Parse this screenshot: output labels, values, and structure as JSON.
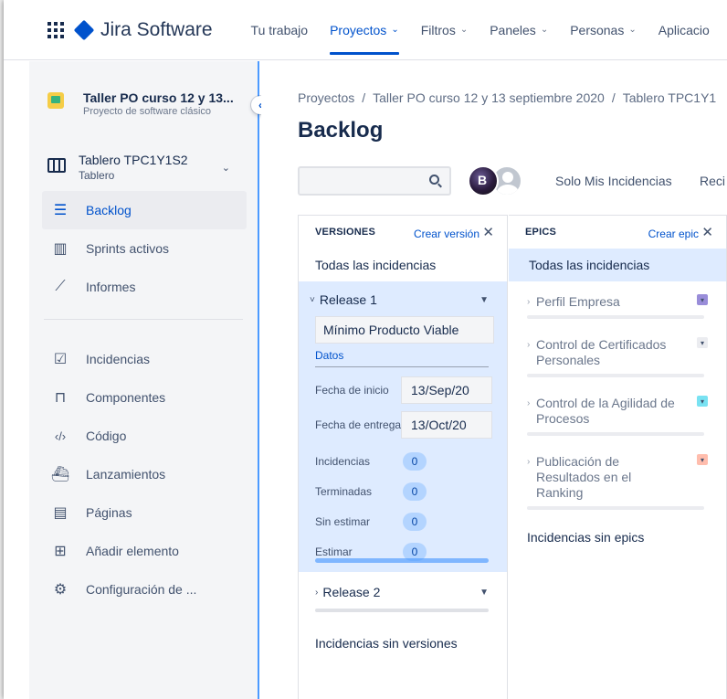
{
  "topnav": {
    "product": "Jira Software",
    "items": [
      {
        "label": "Tu trabajo",
        "chevron": false,
        "active": false
      },
      {
        "label": "Proyectos",
        "chevron": true,
        "active": true
      },
      {
        "label": "Filtros",
        "chevron": true,
        "active": false
      },
      {
        "label": "Paneles",
        "chevron": true,
        "active": false
      },
      {
        "label": "Personas",
        "chevron": true,
        "active": false
      },
      {
        "label": "Aplicacio",
        "chevron": false,
        "active": false
      }
    ],
    "chevron_glyph": "⌄"
  },
  "sidebar": {
    "project": {
      "name": "Taller PO curso 12 y 13...",
      "subtitle": "Proyecto de software clásico"
    },
    "board": {
      "name": "Tablero TPC1Y1S2",
      "subtitle": "Tablero"
    },
    "items": [
      {
        "label": "Backlog",
        "icon": "backlog-icon",
        "active": true
      },
      {
        "label": "Sprints activos",
        "icon": "board-columns-icon",
        "active": false
      },
      {
        "label": "Informes",
        "icon": "reports-icon",
        "active": false
      }
    ],
    "items2": [
      {
        "label": "Incidencias",
        "icon": "issues-icon"
      },
      {
        "label": "Componentes",
        "icon": "components-icon"
      },
      {
        "label": "Código",
        "icon": "code-icon"
      },
      {
        "label": "Lanzamientos",
        "icon": "releases-icon"
      },
      {
        "label": "Páginas",
        "icon": "pages-icon"
      },
      {
        "label": "Añadir elemento",
        "icon": "add-item-icon"
      },
      {
        "label": "Configuración de ...",
        "icon": "gear-icon"
      }
    ]
  },
  "main": {
    "breadcrumb": [
      "Proyectos",
      "Taller PO curso 12 y 13 septiembre 2020",
      "Tablero TPC1Y1"
    ],
    "breadcrumb_sep": "/",
    "title": "Backlog",
    "quickfilters": [
      "Solo Mis Incidencias",
      "Reci"
    ],
    "avatar_initial": "B"
  },
  "versions": {
    "header": "VERSIONES",
    "create": "Crear versión",
    "all": "Todas las incidencias",
    "release1": {
      "name": "Release 1",
      "description": "Mínimo Producto Viable",
      "link": "Datos",
      "start_label": "Fecha de inicio",
      "start": "13/Sep/20",
      "end_label": "Fecha de entrega",
      "end": "13/Oct/20",
      "counts": [
        {
          "label": "Incidencias",
          "value": "0"
        },
        {
          "label": "Terminadas",
          "value": "0"
        },
        {
          "label": "Sin estimar",
          "value": "0"
        },
        {
          "label": "Estimar",
          "value": "0"
        }
      ]
    },
    "release2": {
      "name": "Release 2"
    },
    "no_version": "Incidencias sin versiones"
  },
  "epics": {
    "header": "EPICS",
    "create": "Crear epic",
    "all": "Todas las incidencias",
    "items": [
      {
        "name": "Perfil Empresa",
        "color": "#998DD9"
      },
      {
        "name": "Control de Certificados Personales",
        "color": "#EBECF0"
      },
      {
        "name": "Control de la Agilidad de Procesos",
        "color": "#79E2F2"
      },
      {
        "name": "Publicación de Resultados en el Ranking",
        "color": "#FFBDAD"
      }
    ],
    "no_epic": "Incidencias sin epics"
  },
  "colors": {
    "accent": "#0052CC",
    "selected_bg": "#DEEBFF"
  }
}
